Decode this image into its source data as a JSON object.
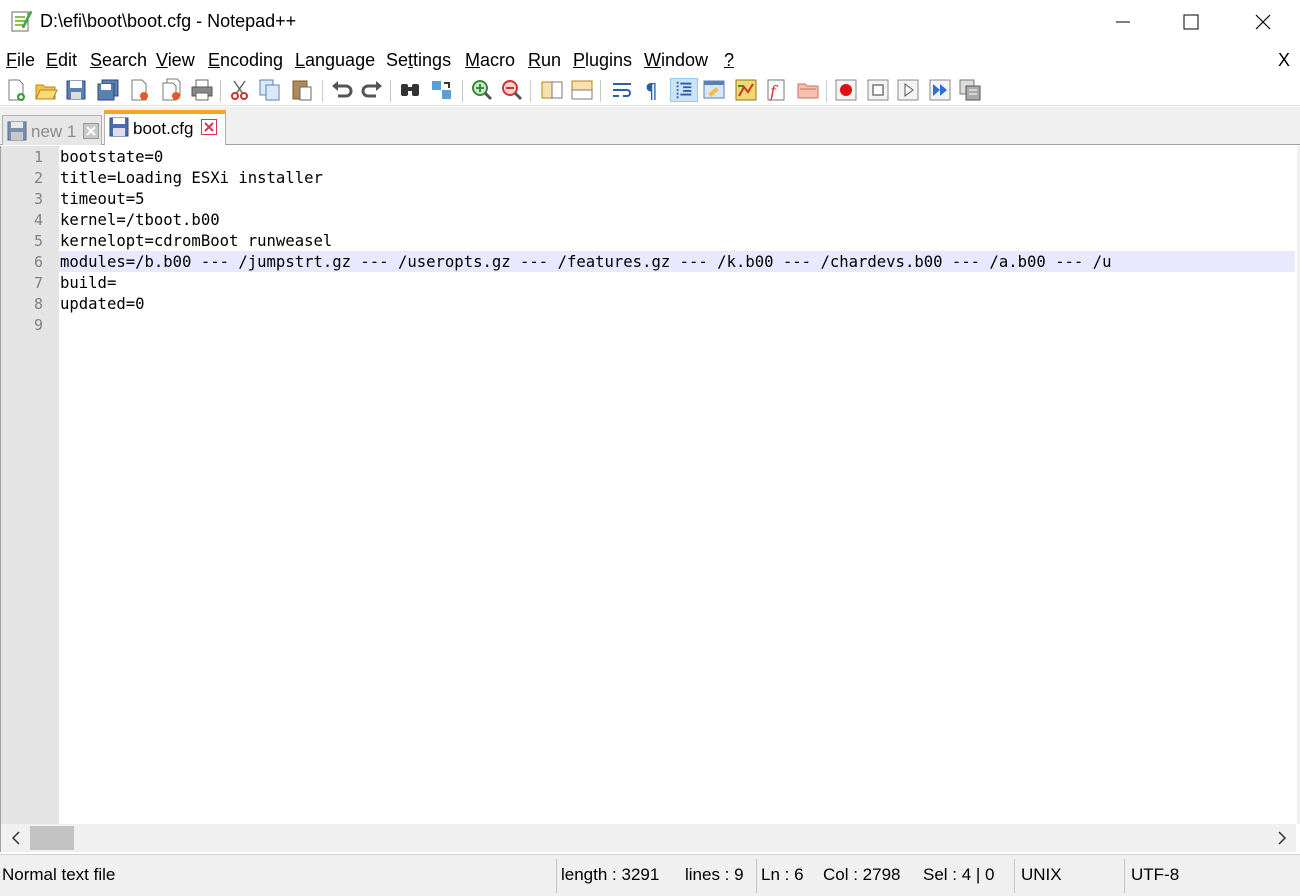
{
  "window": {
    "title": "D:\\efi\\boot\\boot.cfg - Notepad++"
  },
  "menu": {
    "items": [
      {
        "label": "File",
        "ul": "F",
        "rest": "ile"
      },
      {
        "label": "Edit",
        "ul": "E",
        "rest": "dit"
      },
      {
        "label": "Search",
        "ul": "S",
        "rest": "earch"
      },
      {
        "label": "View",
        "ul": "V",
        "rest": "iew"
      },
      {
        "label": "Encoding",
        "pre": "",
        "ul": "E",
        "rest": "ncoding"
      },
      {
        "label": "Language",
        "ul": "L",
        "rest": "anguage"
      },
      {
        "label": "Settings",
        "pre": "Se",
        "ul": "t",
        "rest": "tings"
      },
      {
        "label": "Macro",
        "ul": "M",
        "rest": "acro"
      },
      {
        "label": "Run",
        "ul": "R",
        "rest": "un"
      },
      {
        "label": "Plugins",
        "ul": "P",
        "rest": "lugins"
      },
      {
        "label": "Window",
        "ul": "W",
        "rest": "indow"
      },
      {
        "label": "?",
        "ul": "?",
        "rest": ""
      }
    ],
    "close_label": "X"
  },
  "toolbar": {
    "icons": [
      "new-file-icon",
      "open-file-icon",
      "save-icon",
      "save-all-icon",
      "close-icon",
      "close-all-icon",
      "print-icon",
      "cut-icon",
      "copy-icon",
      "paste-icon",
      "undo-icon",
      "redo-icon",
      "find-icon",
      "replace-icon",
      "zoom-in-icon",
      "zoom-out-icon",
      "sync-vertical-icon",
      "sync-horizontal-icon",
      "word-wrap-icon",
      "show-all-characters-icon",
      "indent-guide-icon",
      "user-defined-language-icon",
      "document-map-icon",
      "function-list-icon",
      "folder-as-workspace-icon",
      "record-macro-icon",
      "stop-recording-icon",
      "playback-macro-icon",
      "run-macro-multiple-icon",
      "save-macro-icon"
    ]
  },
  "tabs": [
    {
      "label": "new 1",
      "active": false
    },
    {
      "label": "boot.cfg",
      "active": true
    }
  ],
  "editor": {
    "current_line": 6,
    "lines": [
      {
        "num": "1",
        "text": "bootstate=0"
      },
      {
        "num": "2",
        "text": "title=Loading ESXi installer"
      },
      {
        "num": "3",
        "text": "timeout=5"
      },
      {
        "num": "4",
        "text": "kernel=/tboot.b00"
      },
      {
        "num": "5",
        "text": "kernelopt=cdromBoot runweasel"
      },
      {
        "num": "6",
        "text": "modules=/b.b00 --- /jumpstrt.gz --- /useropts.gz --- /features.gz --- /k.b00 --- /chardevs.b00 --- /a.b00 --- /u"
      },
      {
        "num": "7",
        "text": "build="
      },
      {
        "num": "8",
        "text": "updated=0"
      },
      {
        "num": "9",
        "text": ""
      }
    ]
  },
  "status": {
    "file_type": "Normal text file",
    "length": "length : 3291",
    "lines": "lines : 9",
    "ln": "Ln : 6",
    "col": "Col : 2798",
    "sel": "Sel : 4 | 0",
    "eol": "UNIX",
    "encoding": "UTF-8"
  },
  "colors": {
    "current_line": "#e8e8ff",
    "gutter": "#e4e4e4",
    "active_tab_accent": "#f5a623",
    "tab_close_red": "#d9364f"
  }
}
